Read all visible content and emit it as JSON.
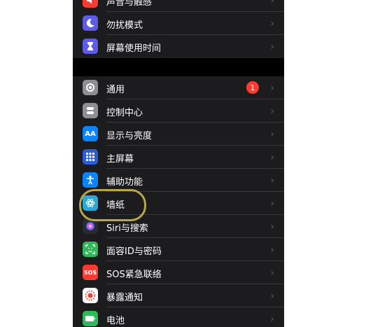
{
  "colors": {
    "sound": "#ff3b30",
    "focus": "#5e5ce6",
    "screen_time": "#5e5ce6",
    "general": "#8e8e93",
    "control_center": "#8e8e93",
    "display": "#0a84ff",
    "home": "#2c5cd6",
    "accessibility": "#0a84ff",
    "wallpaper": "#2aa8d8",
    "siri": "#2b2b2b",
    "face_id": "#30b85a",
    "sos": "#ff3b30",
    "exposure": "#ffffff",
    "battery": "#30b85a",
    "badge": "#ff3b30",
    "annotation": "#b7a64a"
  },
  "settings_top": [
    {
      "label": "声音与触感",
      "icon": "speaker-icon"
    },
    {
      "label": "勿扰模式",
      "icon": "moon-icon"
    },
    {
      "label": "屏幕使用时间",
      "icon": "hourglass-icon"
    }
  ],
  "settings_bottom": [
    {
      "label": "通用",
      "icon": "gear-icon",
      "badge": "1"
    },
    {
      "label": "控制中心",
      "icon": "toggles-icon"
    },
    {
      "label": "显示与亮度",
      "icon": "AA"
    },
    {
      "label": "主屏幕",
      "icon": "grid-icon"
    },
    {
      "label": "辅助功能",
      "icon": "accessibility-icon"
    },
    {
      "label": "墙纸",
      "icon": "flower-icon"
    },
    {
      "label": "Siri与搜索",
      "icon": "siri-icon"
    },
    {
      "label": "面容ID与密码",
      "icon": "faceid-icon"
    },
    {
      "label": "SOS紧急联络",
      "icon": "SOS"
    },
    {
      "label": "暴露通知",
      "icon": "exposure-icon"
    },
    {
      "label": "电池",
      "icon": "battery-icon"
    }
  ]
}
